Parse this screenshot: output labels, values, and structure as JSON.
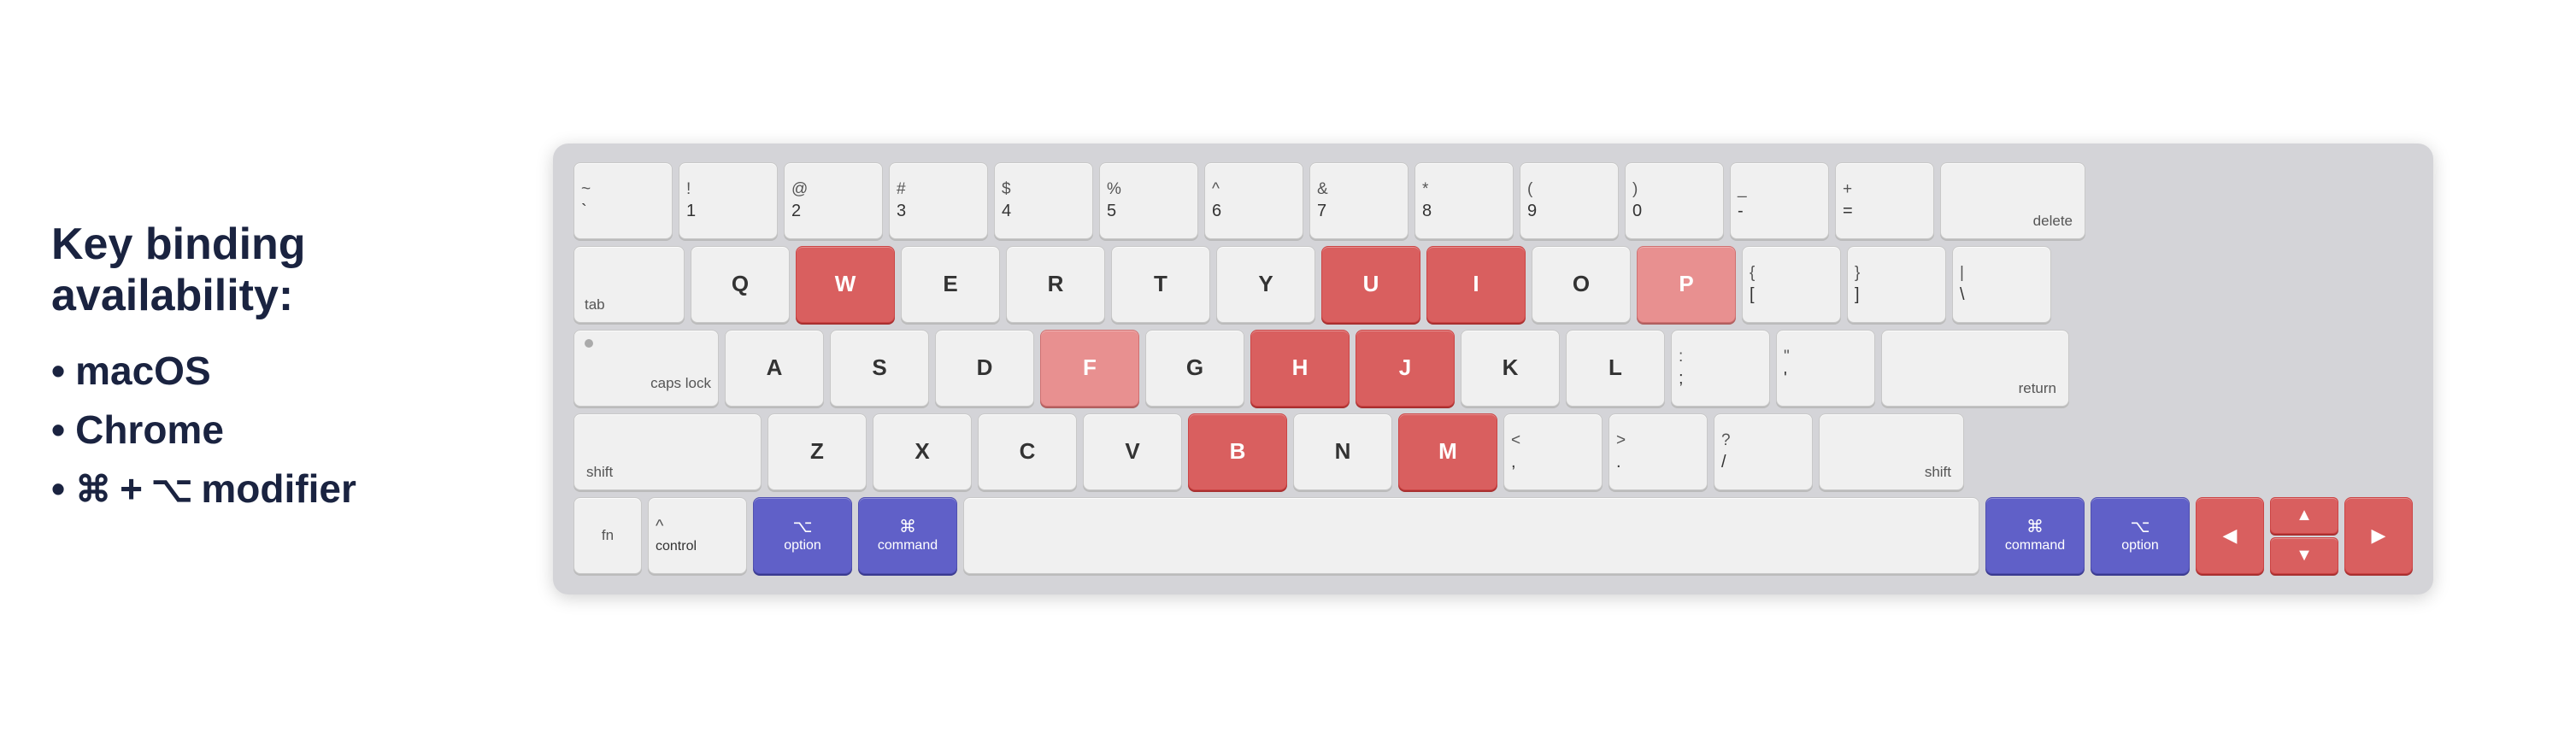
{
  "left": {
    "title": "Key binding\navailability:",
    "items": [
      {
        "id": "macos",
        "label": "macOS"
      },
      {
        "id": "chrome",
        "label": "Chrome"
      },
      {
        "id": "modifier",
        "parts": [
          "⌘",
          "+",
          "⌥",
          "modifier"
        ]
      }
    ]
  },
  "keyboard": {
    "rows": [
      {
        "id": "number-row",
        "keys": [
          {
            "id": "backtick",
            "top": "~",
            "bottom": "`",
            "style": "std"
          },
          {
            "id": "1",
            "top": "!",
            "bottom": "1",
            "style": "std"
          },
          {
            "id": "2",
            "top": "@",
            "bottom": "2",
            "style": "std"
          },
          {
            "id": "3",
            "top": "#",
            "bottom": "3",
            "style": "std"
          },
          {
            "id": "4",
            "top": "$",
            "bottom": "4",
            "style": "std"
          },
          {
            "id": "5",
            "top": "%",
            "bottom": "5",
            "style": "std"
          },
          {
            "id": "6",
            "top": "^",
            "bottom": "6",
            "style": "std"
          },
          {
            "id": "7",
            "top": "&",
            "bottom": "7",
            "style": "std"
          },
          {
            "id": "8",
            "top": "*",
            "bottom": "8",
            "style": "std"
          },
          {
            "id": "9",
            "top": "(",
            "bottom": "9",
            "style": "std"
          },
          {
            "id": "0",
            "top": ")",
            "bottom": "0",
            "style": "std"
          },
          {
            "id": "minus",
            "top": "_",
            "bottom": "-",
            "style": "std"
          },
          {
            "id": "equals",
            "top": "+",
            "bottom": "=",
            "style": "std"
          },
          {
            "id": "delete",
            "label": "delete",
            "style": "wider",
            "labelPos": "right"
          }
        ]
      },
      {
        "id": "qwerty-row",
        "keys": [
          {
            "id": "tab",
            "label": "tab",
            "style": "wide",
            "labelPos": "left"
          },
          {
            "id": "q",
            "label": "Q",
            "style": "std"
          },
          {
            "id": "w",
            "label": "W",
            "style": "std",
            "highlight": "red-dark"
          },
          {
            "id": "e",
            "label": "E",
            "style": "std"
          },
          {
            "id": "r",
            "label": "R",
            "style": "std"
          },
          {
            "id": "t",
            "label": "T",
            "style": "std"
          },
          {
            "id": "y",
            "label": "Y",
            "style": "std"
          },
          {
            "id": "u",
            "label": "U",
            "style": "std",
            "highlight": "red-dark"
          },
          {
            "id": "i",
            "label": "I",
            "style": "std",
            "highlight": "red-dark"
          },
          {
            "id": "o",
            "label": "O",
            "style": "std"
          },
          {
            "id": "p",
            "label": "P",
            "style": "std",
            "highlight": "red-light"
          },
          {
            "id": "bracket-open",
            "top": "{",
            "bottom": "[",
            "style": "std"
          },
          {
            "id": "bracket-close",
            "top": "}",
            "bottom": "]",
            "style": "std"
          },
          {
            "id": "backslash",
            "top": "|",
            "bottom": "\\",
            "style": "std"
          }
        ]
      },
      {
        "id": "asdf-row",
        "keys": [
          {
            "id": "caps-lock",
            "label": "caps lock",
            "style": "wider",
            "labelPos": "left"
          },
          {
            "id": "a",
            "label": "A",
            "style": "std"
          },
          {
            "id": "s",
            "label": "S",
            "style": "std"
          },
          {
            "id": "d",
            "label": "D",
            "style": "std"
          },
          {
            "id": "f",
            "label": "F",
            "style": "std",
            "highlight": "red-light"
          },
          {
            "id": "g",
            "label": "G",
            "style": "std"
          },
          {
            "id": "h",
            "label": "H",
            "style": "std",
            "highlight": "red-dark"
          },
          {
            "id": "j",
            "label": "J",
            "style": "std",
            "highlight": "red-dark"
          },
          {
            "id": "k",
            "label": "K",
            "style": "std"
          },
          {
            "id": "l",
            "label": "L",
            "style": "std"
          },
          {
            "id": "semicolon",
            "top": ":",
            "bottom": ";",
            "style": "std"
          },
          {
            "id": "quote",
            "top": "\"",
            "bottom": "'",
            "style": "std"
          },
          {
            "id": "return",
            "label": "return",
            "style": "widest",
            "labelPos": "right"
          }
        ]
      },
      {
        "id": "zxcv-row",
        "keys": [
          {
            "id": "shift-left",
            "label": "shift",
            "style": "widest",
            "labelPos": "left"
          },
          {
            "id": "z",
            "label": "Z",
            "style": "std"
          },
          {
            "id": "x",
            "label": "X",
            "style": "std"
          },
          {
            "id": "c",
            "label": "C",
            "style": "std"
          },
          {
            "id": "v",
            "label": "V",
            "style": "std"
          },
          {
            "id": "b",
            "label": "B",
            "style": "std",
            "highlight": "red-dark"
          },
          {
            "id": "n",
            "label": "N",
            "style": "std"
          },
          {
            "id": "m",
            "label": "M",
            "style": "std",
            "highlight": "red-dark"
          },
          {
            "id": "comma",
            "top": "<",
            "bottom": ",",
            "style": "std"
          },
          {
            "id": "period",
            "top": ">",
            "bottom": ".",
            "style": "std"
          },
          {
            "id": "slash",
            "top": "?",
            "bottom": "/",
            "style": "std"
          },
          {
            "id": "shift-right",
            "label": "shift",
            "style": "wider",
            "labelPos": "right"
          }
        ]
      },
      {
        "id": "bottom-row",
        "keys": [
          {
            "id": "fn",
            "label": "fn",
            "style": "fn-key"
          },
          {
            "id": "control",
            "top": "^",
            "bottom": "control",
            "style": "std"
          },
          {
            "id": "option-left",
            "top": "⌥",
            "bottom": "option",
            "style": "std",
            "highlight": "blue"
          },
          {
            "id": "command-left",
            "top": "⌘",
            "bottom": "command",
            "style": "std",
            "highlight": "blue"
          },
          {
            "id": "space",
            "label": "",
            "style": "spacebar"
          },
          {
            "id": "command-right",
            "top": "⌘",
            "bottom": "command",
            "style": "std",
            "highlight": "blue"
          },
          {
            "id": "option-right",
            "top": "⌥",
            "bottom": "option",
            "style": "std",
            "highlight": "blue"
          }
        ]
      }
    ],
    "arrows": {
      "left": "◀",
      "up": "▲",
      "down": "▼",
      "right": "▶"
    }
  }
}
